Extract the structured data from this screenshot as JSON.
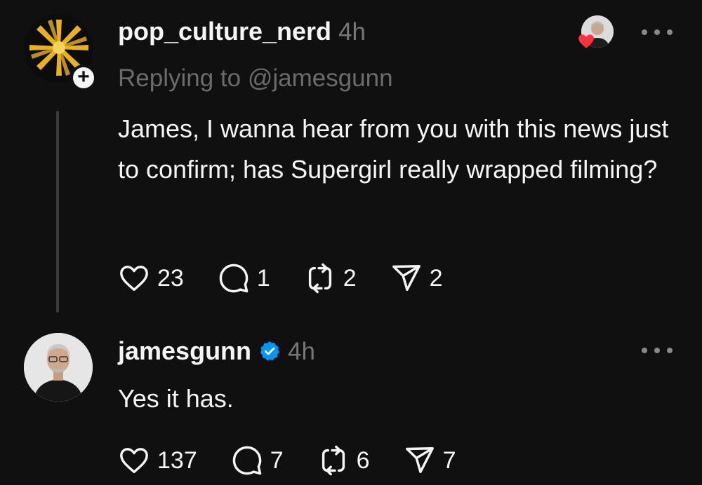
{
  "posts": [
    {
      "username": "pop_culture_nerd",
      "time": "4h",
      "replying_to": "Replying to @jamesgunn",
      "text": "James, I wanna hear from you with this news just to confirm; has Supergirl really wrapped filming?",
      "verified": false,
      "follow_badge": "+",
      "counts": {
        "likes": "23",
        "replies": "1",
        "reposts": "2",
        "shares": "2"
      }
    },
    {
      "username": "jamesgunn",
      "time": "4h",
      "text": "Yes it has.",
      "verified": true,
      "counts": {
        "likes": "137",
        "replies": "7",
        "reposts": "6",
        "shares": "7"
      }
    }
  ],
  "icons": {
    "like": "heart-outline-icon",
    "reply": "speech-bubble-icon",
    "repost": "repost-arrows-icon",
    "share": "send-paper-plane-icon",
    "more": "more-horizontal-icon",
    "verified": "verified-badge-icon",
    "liked_by": "red-heart-icon"
  },
  "colors": {
    "background": "#101010",
    "text": "#f3f5f7",
    "muted": "#777777",
    "verified": "#0095f6",
    "heart": "#ff3040"
  }
}
